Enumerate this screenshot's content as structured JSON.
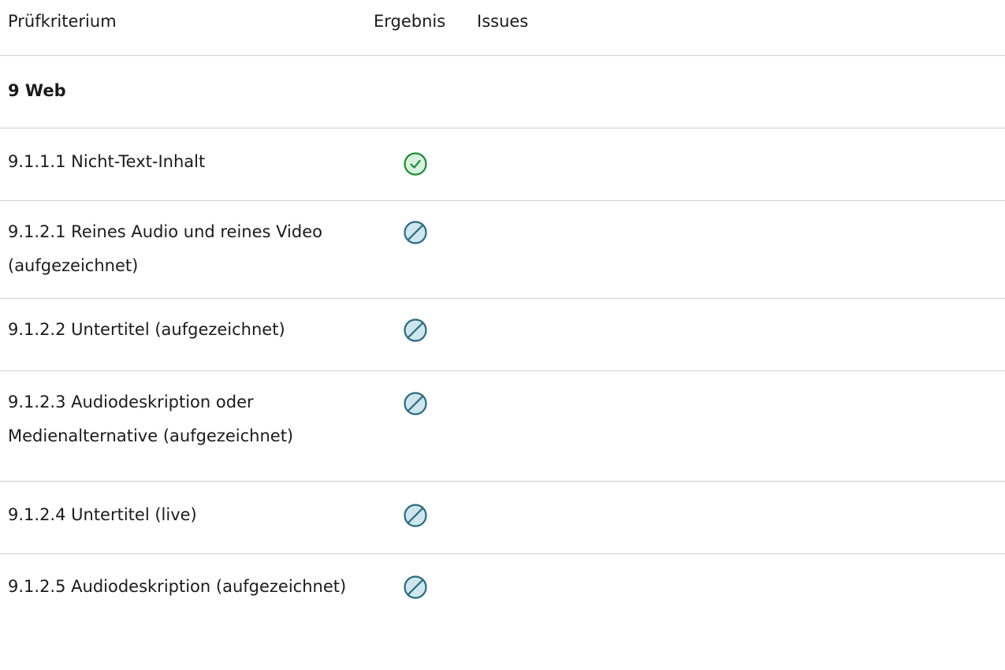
{
  "header": {
    "kriterium": "Prüfkriterium",
    "ergebnis": "Ergebnis",
    "issues": "Issues"
  },
  "section": {
    "title": "9 Web"
  },
  "rows": [
    {
      "label": "9.1.1.1 Nicht-Text-Inhalt",
      "result": "pass",
      "result_icon": "check-circle-icon"
    },
    {
      "label": "9.1.2.1 Reines Audio und reines Video (aufgezeichnet)",
      "result": "not-applicable",
      "result_icon": "not-applicable-icon"
    },
    {
      "label": "9.1.2.2 Untertitel (aufgezeichnet)",
      "result": "not-applicable",
      "result_icon": "not-applicable-icon"
    },
    {
      "label": "9.1.2.3 Audiodeskription oder Medienalternative (aufgezeichnet)",
      "result": "not-applicable",
      "result_icon": "not-applicable-icon"
    },
    {
      "label": "9.1.2.4 Untertitel (live)",
      "result": "not-applicable",
      "result_icon": "not-applicable-icon"
    },
    {
      "label": "9.1.2.5 Audiodeskription (aufgezeichnet)",
      "result": "not-applicable",
      "result_icon": "not-applicable-icon"
    }
  ],
  "colors": {
    "pass_stroke": "#1f8a3a",
    "pass_fill": "#d8f1dd",
    "na_stroke": "#2d6a80",
    "na_fill": "#cfe6ef",
    "divider": "#d2d2d2"
  }
}
